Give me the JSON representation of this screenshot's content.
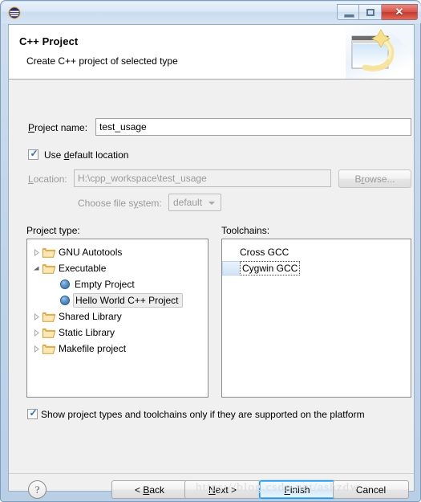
{
  "window": {
    "app_icon": "eclipse-icon",
    "controls": {
      "minimize": "minimize-icon",
      "maximize": "maximize-icon",
      "close": "✕"
    }
  },
  "banner": {
    "title": "C++ Project",
    "subtitle": "Create C++ project of selected type",
    "art": "wizard-banner-icon"
  },
  "form": {
    "project_name_label_pre": "P",
    "project_name_label_post": "roject name:",
    "project_name_value": "test_usage",
    "project_name_placeholder": "",
    "use_default_location": {
      "checked": true,
      "label_pre": "Use ",
      "label_mn": "d",
      "label_post": "efault location"
    },
    "location_label_pre": "L",
    "location_label_post": "ocation:",
    "location_value": "H:\\cpp_workspace\\test_usage",
    "browse_pre": "B",
    "browse_mn": "r",
    "browse_post": "owse...",
    "filesystem_label_pre": "Choose file s",
    "filesystem_label_mn": "y",
    "filesystem_label_post": "stem:",
    "filesystem_value": "default"
  },
  "project_type": {
    "label": "Project type:",
    "nodes": [
      {
        "label": "GNU Autotools",
        "type": "folder",
        "state": "collapsed",
        "indent": 0,
        "selected": false
      },
      {
        "label": "Executable",
        "type": "folder",
        "state": "expanded",
        "indent": 0,
        "selected": false
      },
      {
        "label": "Empty Project",
        "type": "leaf",
        "state": "none",
        "indent": 1,
        "selected": false
      },
      {
        "label": "Hello World C++ Project",
        "type": "leaf",
        "state": "none",
        "indent": 1,
        "selected": true
      },
      {
        "label": "Shared Library",
        "type": "folder",
        "state": "collapsed",
        "indent": 0,
        "selected": false
      },
      {
        "label": "Static Library",
        "type": "folder",
        "state": "collapsed",
        "indent": 0,
        "selected": false
      },
      {
        "label": "Makefile project",
        "type": "folder",
        "state": "collapsed",
        "indent": 0,
        "selected": false
      }
    ]
  },
  "toolchains": {
    "label": "Toolchains:",
    "items": [
      {
        "label": "Cross GCC",
        "selected": false
      },
      {
        "label": "Cygwin GCC",
        "selected": true
      }
    ]
  },
  "show_supported": {
    "checked": true,
    "label": "Show project types and toolchains only if they are supported on the platform"
  },
  "footer": {
    "help": "?",
    "back_pre": "< ",
    "back_mn": "B",
    "back_post": "ack",
    "next_mn": "N",
    "next_post": "ext >",
    "finish_mn": "F",
    "finish_post": "inish",
    "cancel": "Cancel"
  },
  "watermark": "https://blog.csdn.net/ashzdw",
  "colors": {
    "accent": "#2c91d8",
    "close_button": "#d9544a",
    "dialog_bg": "#f0f0f0",
    "banner_bg": "#ffffff"
  }
}
